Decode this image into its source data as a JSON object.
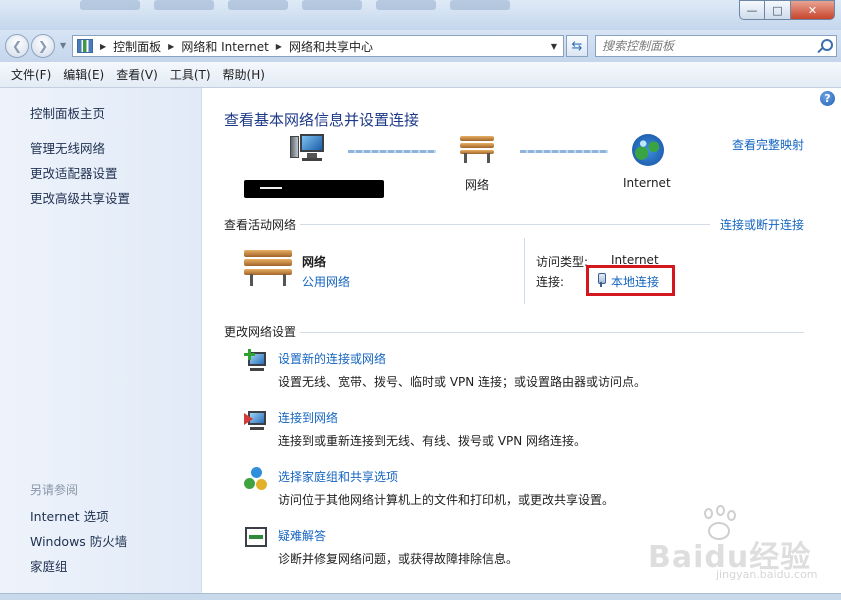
{
  "window": {
    "controls": {
      "minimize": "—",
      "maximize": "□",
      "close": "✕"
    }
  },
  "nav": {
    "back_icon": "❮",
    "forward_icon": "❯",
    "breadcrumb": [
      "控制面板",
      "网络和 Internet",
      "网络和共享中心"
    ],
    "search_placeholder": "搜索控制面板"
  },
  "menu": [
    "文件(F)",
    "编辑(E)",
    "查看(V)",
    "工具(T)",
    "帮助(H)"
  ],
  "sidebar": {
    "items": [
      "控制面板主页",
      "管理无线网络",
      "更改适配器设置",
      "更改高级共享设置"
    ],
    "see_also_heading": "另请参阅",
    "see_also": [
      "Internet 选项",
      "Windows 防火墙",
      "家庭组"
    ]
  },
  "main": {
    "title": "查看基本网络信息并设置连接",
    "full_map_link": "查看完整映射",
    "map": {
      "network_label": "网络",
      "internet_label": "Internet"
    },
    "active_networks": {
      "heading": "查看活动网络",
      "connect_link": "连接或断开连接",
      "network_name": "网络",
      "network_type": "公用网络",
      "access_type_label": "访问类型:",
      "access_type_value": "Internet",
      "connections_label": "连接:",
      "connection_value": "本地连接"
    },
    "change_settings": {
      "heading": "更改网络设置",
      "tasks": [
        {
          "title": "设置新的连接或网络",
          "desc": "设置无线、宽带、拨号、临时或 VPN 连接；或设置路由器或访问点。"
        },
        {
          "title": "连接到网络",
          "desc": "连接到或重新连接到无线、有线、拨号或 VPN 网络连接。"
        },
        {
          "title": "选择家庭组和共享选项",
          "desc": "访问位于其他网络计算机上的文件和打印机，或更改共享设置。"
        },
        {
          "title": "疑难解答",
          "desc": "诊断并修复网络问题，或获得故障排除信息。"
        }
      ]
    }
  },
  "watermark": {
    "brand": "Baidu经验",
    "url": "jingyan.baidu.com"
  },
  "colors": {
    "link": "#1565c0",
    "title": "#1d3a88",
    "highlight_box": "#d4161f"
  }
}
